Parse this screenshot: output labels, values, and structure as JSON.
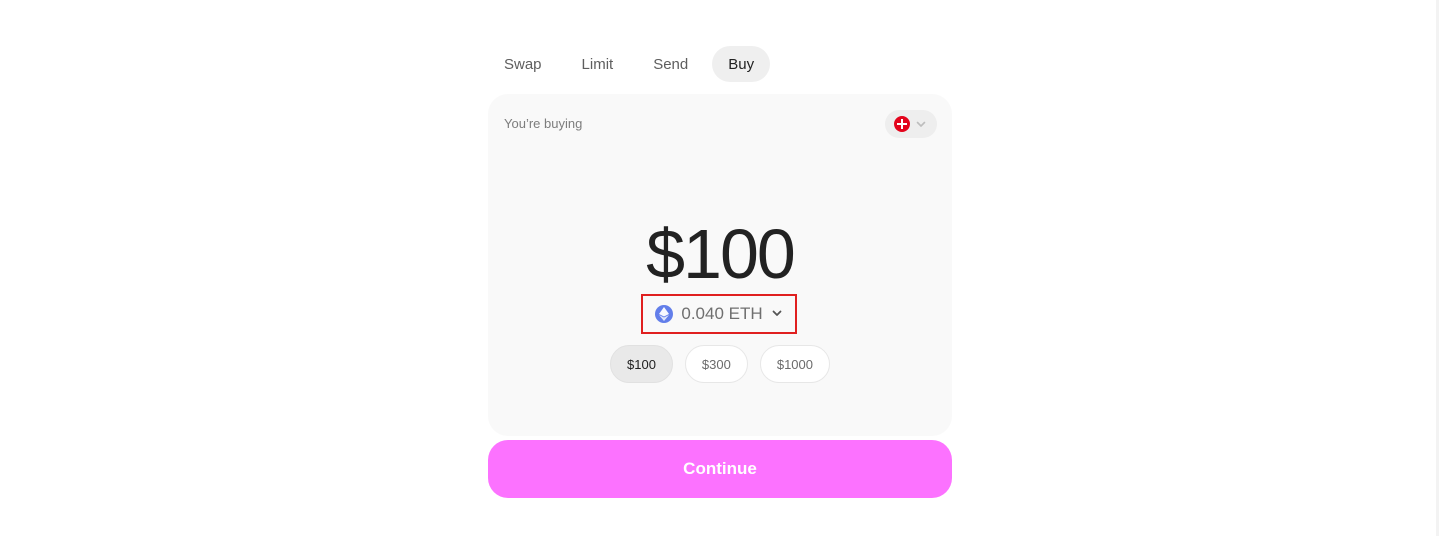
{
  "tabs": [
    {
      "label": "Swap"
    },
    {
      "label": "Limit"
    },
    {
      "label": "Send"
    },
    {
      "label": "Buy"
    }
  ],
  "active_tab": "Buy",
  "card": {
    "label": "You’re buying",
    "country_flag": "switzerland-flag-icon",
    "amount": "$100",
    "token": {
      "amount_text": "0.040 ETH",
      "icon": "eth-icon",
      "color": "#627eea"
    },
    "presets": [
      {
        "label": "$100",
        "selected": true
      },
      {
        "label": "$300",
        "selected": false
      },
      {
        "label": "$1000",
        "selected": false
      }
    ]
  },
  "continue_label": "Continue",
  "colors": {
    "accent": "#fc72ff",
    "highlight_border": "#e02020"
  }
}
